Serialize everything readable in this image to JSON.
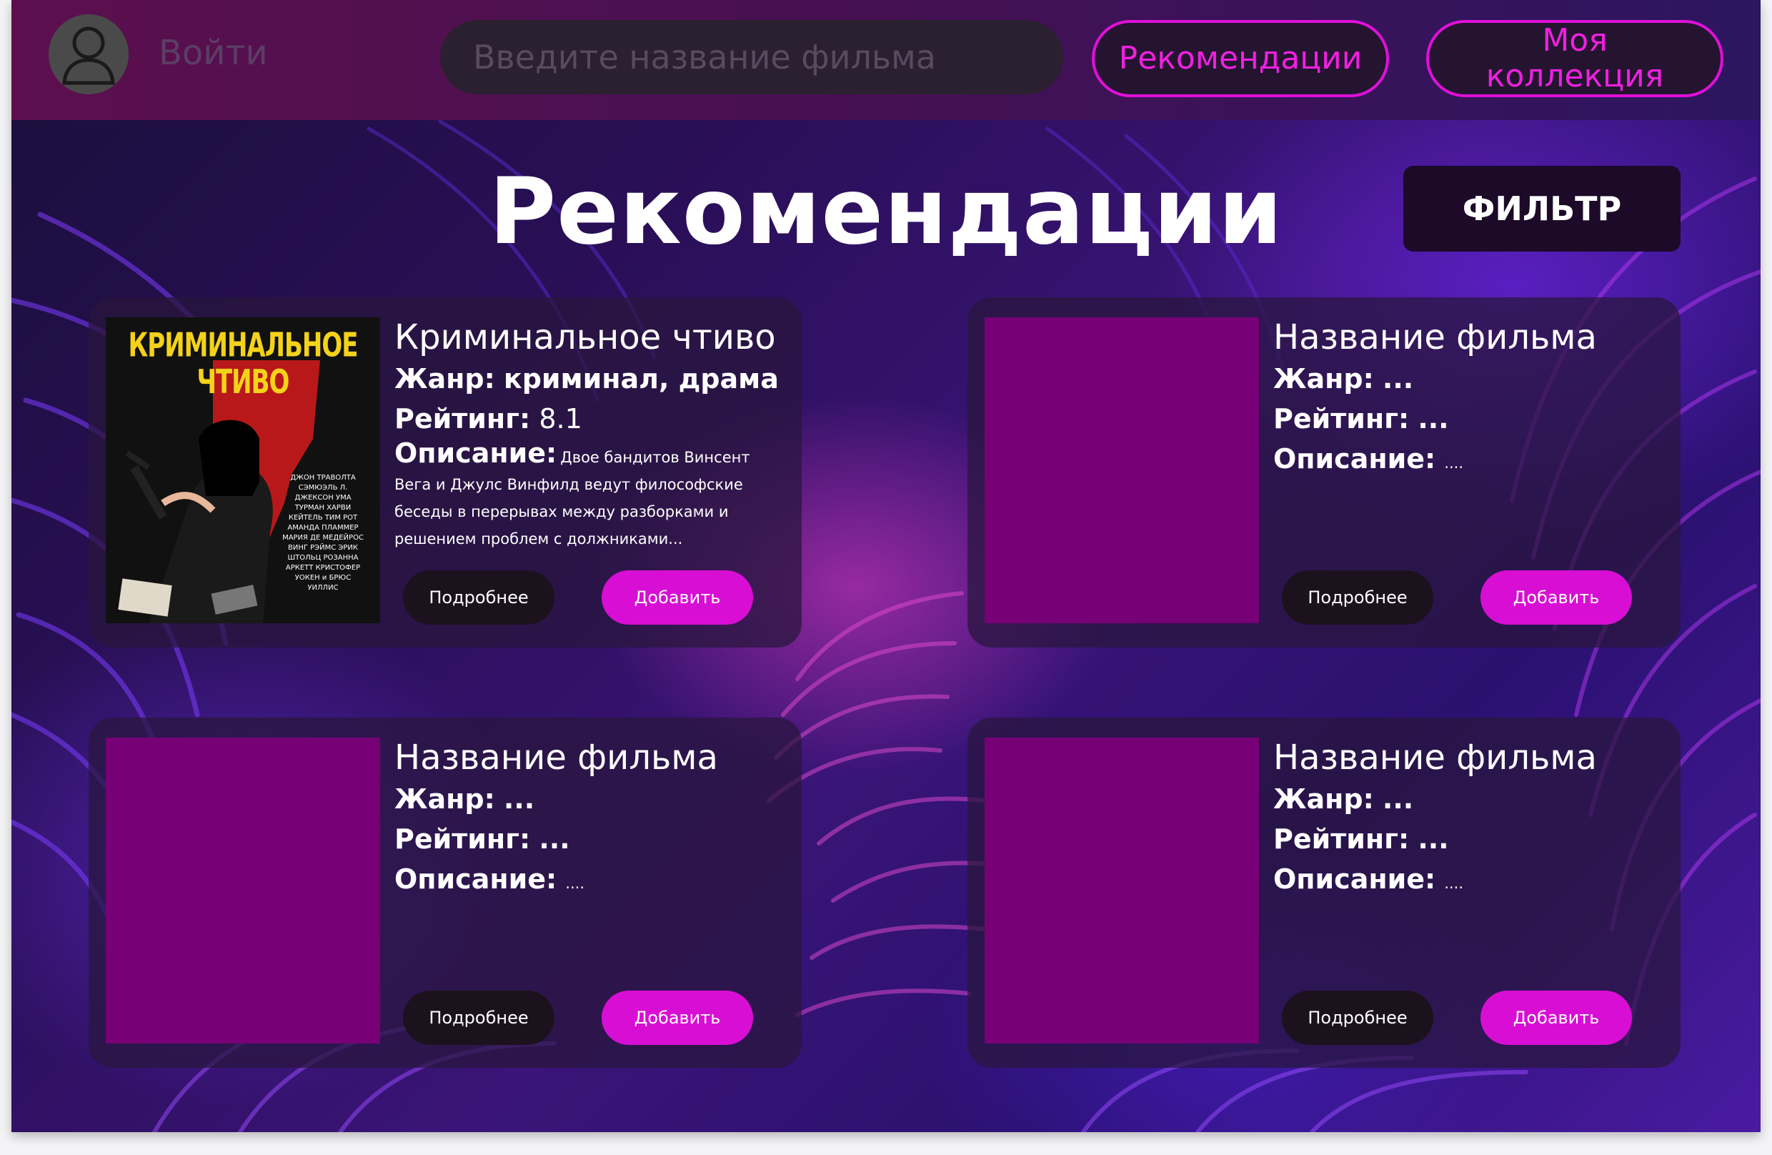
{
  "header": {
    "login_label": "Войти",
    "search_placeholder": "Введите название фильма",
    "nav_recommendations": "Рекомендации",
    "nav_collection": "Моя коллекция"
  },
  "main": {
    "title": "Рекомендации",
    "filter_label": "ФИЛЬТР"
  },
  "cards": [
    {
      "title": "Криминальное чтиво",
      "genre_label": "Жанр:",
      "genre_value": "криминал, драма",
      "rating_label": "Рейтинг:",
      "rating_value": "8.1",
      "description_label": "Описание:",
      "description_value": "Двое бандитов Винсент Вега и Джулс Винфилд ведут философские беседы в перерывах между разборками и решением проблем с должниками...",
      "poster_title": "КРИМИНАЛЬНОЕ ЧТИВО",
      "poster_credits": "ДЖОН ТРАВОЛТА СЭМЮЭЛЬ Л. ДЖЕКСОН УМА ТУРМАН ХАРВИ КЕЙТЕЛЬ ТИМ РОТ АМАНДА ПЛАММЕР МАРИЯ ДЕ МЕДЕЙРОС ВИНГ РЭЙМС ЭРИК ШТОЛЬЦ РОЗАННА АРКЕТТ КРИСТОФЕР УОКЕН и БРЮС УИЛЛИС",
      "more_label": "Подробнее",
      "add_label": "Добавить"
    },
    {
      "title": "Название фильма",
      "genre_label": "Жанр:",
      "genre_value": "...",
      "rating_label": "Рейтинг:",
      "rating_value": "...",
      "description_label": "Описание:",
      "description_value": "....",
      "more_label": "Подробнее",
      "add_label": "Добавить"
    },
    {
      "title": "Название фильма",
      "genre_label": "Жанр:",
      "genre_value": "...",
      "rating_label": "Рейтинг:",
      "rating_value": "...",
      "description_label": "Описание:",
      "description_value": "....",
      "more_label": "Подробнее",
      "add_label": "Добавить"
    },
    {
      "title": "Название фильма",
      "genre_label": "Жанр:",
      "genre_value": "...",
      "rating_label": "Рейтинг:",
      "rating_value": "...",
      "description_label": "Описание:",
      "description_value": "....",
      "more_label": "Подробнее",
      "add_label": "Добавить"
    }
  ],
  "colors": {
    "accent": "#d80ed4",
    "poster_placeholder": "#770077",
    "header_start": "#5c0f4e",
    "header_end": "#2c1660"
  },
  "icons": {
    "avatar": "user-avatar-icon"
  }
}
